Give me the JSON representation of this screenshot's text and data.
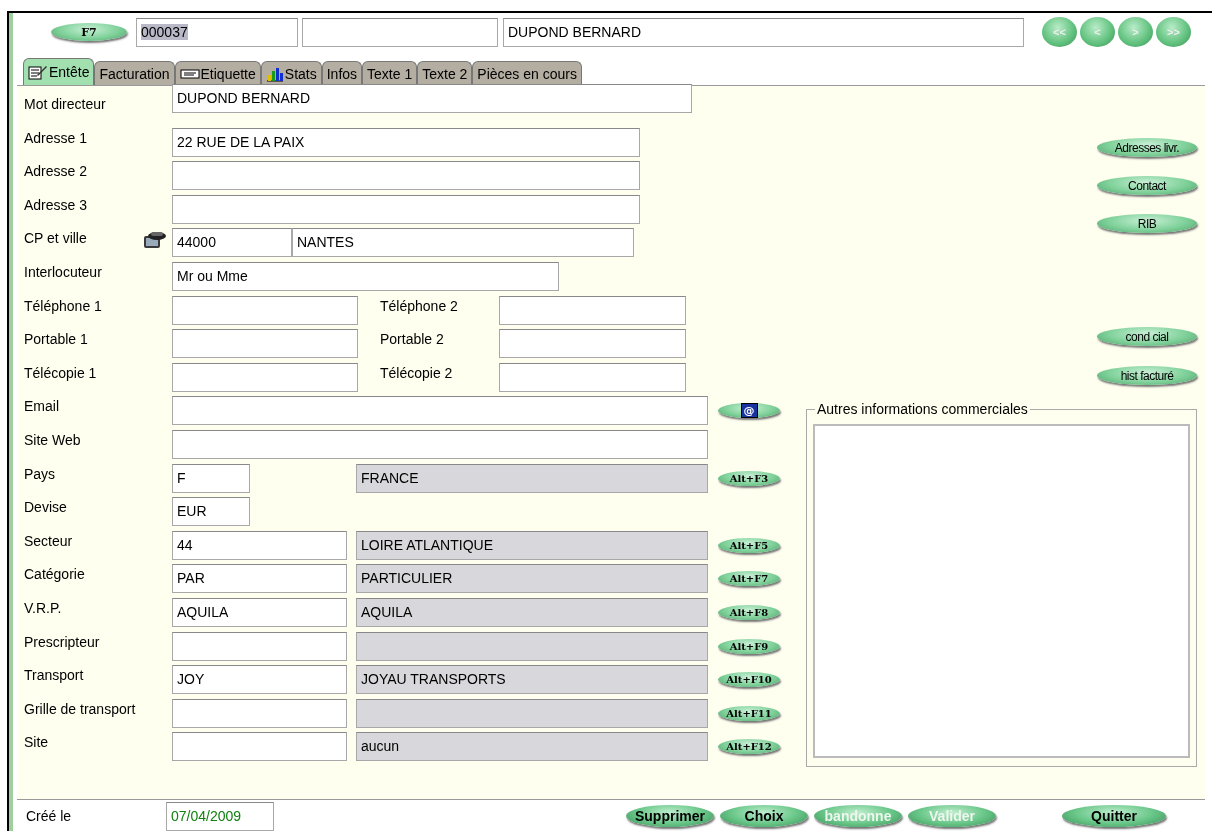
{
  "header": {
    "shortcut_button": "F7",
    "code": {
      "value": "000037",
      "selected": true
    },
    "name": "DUPOND BERNARD",
    "nav_buttons": [
      "<<",
      "<",
      ">",
      ">>"
    ]
  },
  "tabs": [
    {
      "label": "Entête",
      "kind": "edit",
      "selected": true
    },
    {
      "label": "Facturation",
      "selected": false
    },
    {
      "label": "Etiquette",
      "kind": "tag",
      "selected": false
    },
    {
      "label": "Stats",
      "kind": "chart",
      "selected": false
    },
    {
      "label": "Infos",
      "selected": false
    },
    {
      "label": "Texte 1",
      "selected": false
    },
    {
      "label": "Texte 2",
      "selected": false
    },
    {
      "label": "Pièces en cours",
      "selected": false
    }
  ],
  "form": [
    {
      "kind": "director",
      "label": "Mot directeur",
      "value": "DUPOND BERNARD"
    },
    {
      "kind": "address",
      "label": "Adresse 1",
      "value": "22 RUE DE LA PAIX"
    },
    {
      "kind": "address",
      "label": "Adresse 2"
    },
    {
      "kind": "address",
      "label": "Adresse 3"
    },
    {
      "kind": "city",
      "label": "CP et ville",
      "value": "44000",
      "city": "NANTES"
    },
    {
      "kind": "contact",
      "label": "Interlocuteur",
      "value": "Mr ou Mme"
    },
    {
      "kind": "pair",
      "label": "Téléphone 1",
      "label_2": "Téléphone 2"
    },
    {
      "kind": "pair",
      "label": "Portable 1",
      "label_2": "Portable 2"
    },
    {
      "kind": "pair",
      "label": "Télécopie 1",
      "label_2": "Télécopie 2"
    },
    {
      "kind": "web",
      "label": "Email",
      "button": "@"
    },
    {
      "kind": "web",
      "label": "Site Web"
    },
    {
      "kind": "country",
      "label": "Pays",
      "value": "F",
      "description": "FRANCE",
      "button": "Alt+F3"
    },
    {
      "kind": "code",
      "label": "Devise",
      "value": "EUR"
    },
    {
      "kind": "lookup",
      "label": "Secteur",
      "value": "44",
      "description": "LOIRE ATLANTIQUE",
      "button": "Alt+F5"
    },
    {
      "kind": "lookup",
      "label": "Catégorie",
      "value": "PAR",
      "description": "PARTICULIER",
      "button": "Alt+F7"
    },
    {
      "kind": "lookup",
      "label": "V.R.P.",
      "value": "AQUILA",
      "description": "AQUILA",
      "button": "Alt+F8"
    },
    {
      "kind": "lookup",
      "label": "Prescripteur",
      "button": "Alt+F9"
    },
    {
      "kind": "lookup",
      "label": "Transport",
      "value": "JOY",
      "description": "JOYAU TRANSPORTS",
      "button": "Alt+F10"
    },
    {
      "kind": "lookup",
      "label": "Grille de transport",
      "button": "Alt+F11"
    },
    {
      "kind": "lookup",
      "label": "Site",
      "description": "aucun",
      "button": "Alt+F12"
    }
  ],
  "side_buttons_top": [
    "Adresses livr.",
    "Contact",
    "RIB"
  ],
  "side_buttons_bottom": [
    "cond cial",
    "hist facturé"
  ],
  "notes_group": {
    "title": "Autres informations commerciales"
  },
  "footer": {
    "created_label": "Créé le",
    "created_date": "07/04/2009",
    "buttons": [
      {
        "label": "Supprimer",
        "disabled": false
      },
      {
        "label": "Choix",
        "disabled": false
      },
      {
        "label": "bandonne",
        "disabled": true
      },
      {
        "label": "Valider",
        "disabled": true
      },
      {
        "label": "Quitter",
        "disabled": false
      }
    ]
  }
}
